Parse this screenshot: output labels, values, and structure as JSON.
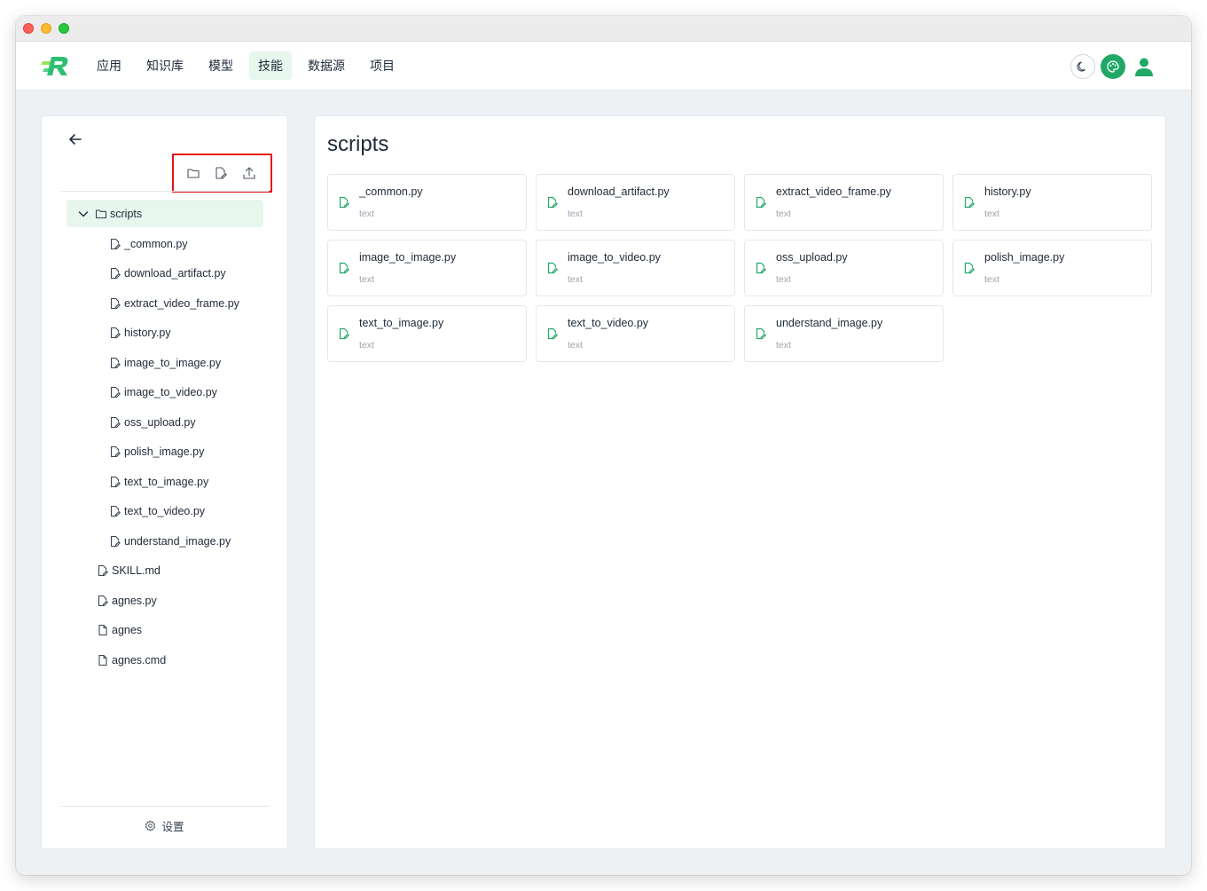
{
  "nav": {
    "items": [
      "应用",
      "知识库",
      "模型",
      "技能",
      "数据源",
      "项目"
    ],
    "active": "技能"
  },
  "colors": {
    "accent": "#22a866",
    "accent_light": "#e8f7ee",
    "highlight_box": "#e3151a"
  },
  "sidebar": {
    "folder": "scripts",
    "folder_children": [
      "_common.py",
      "download_artifact.py",
      "extract_video_frame.py",
      "history.py",
      "image_to_image.py",
      "image_to_video.py",
      "oss_upload.py",
      "polish_image.py",
      "text_to_image.py",
      "text_to_video.py",
      "understand_image.py"
    ],
    "root_files": [
      {
        "name": "SKILL.md",
        "icon": "file-edit-icon"
      },
      {
        "name": "agnes.py",
        "icon": "file-edit-icon"
      },
      {
        "name": "agnes",
        "icon": "file-icon"
      },
      {
        "name": "agnes.cmd",
        "icon": "file-icon"
      }
    ],
    "settings_label": "设置"
  },
  "main": {
    "title": "scripts",
    "files": [
      {
        "name": "_common.py",
        "type": "text"
      },
      {
        "name": "download_artifact.py",
        "type": "text"
      },
      {
        "name": "extract_video_frame.py",
        "type": "text"
      },
      {
        "name": "history.py",
        "type": "text"
      },
      {
        "name": "image_to_image.py",
        "type": "text"
      },
      {
        "name": "image_to_video.py",
        "type": "text"
      },
      {
        "name": "oss_upload.py",
        "type": "text"
      },
      {
        "name": "polish_image.py",
        "type": "text"
      },
      {
        "name": "text_to_image.py",
        "type": "text"
      },
      {
        "name": "text_to_video.py",
        "type": "text"
      },
      {
        "name": "understand_image.py",
        "type": "text"
      }
    ]
  }
}
